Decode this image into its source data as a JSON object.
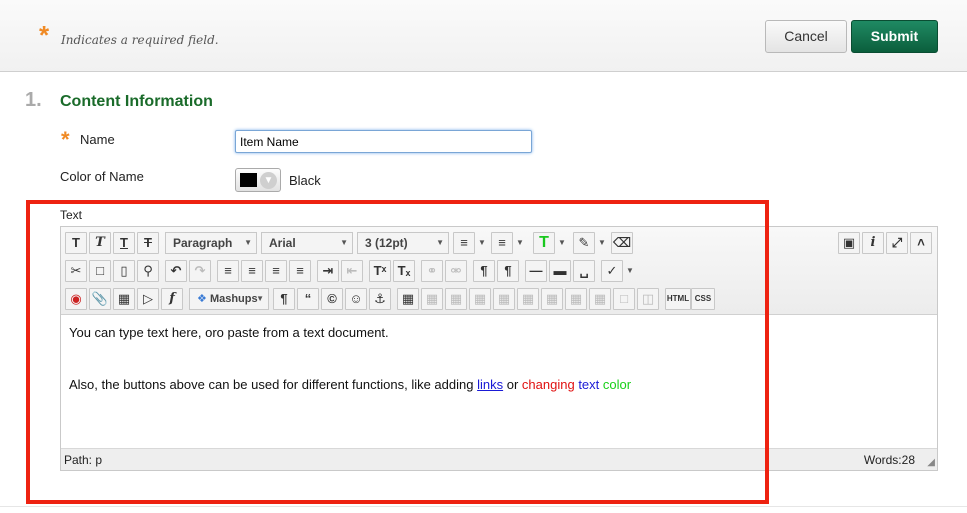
{
  "header": {
    "required_star": "*",
    "required_note": "Indicates a required field.",
    "cancel_label": "Cancel",
    "submit_label": "Submit"
  },
  "section": {
    "number": "1.",
    "title": "Content Information"
  },
  "form": {
    "name_star": "*",
    "name_label": "Name",
    "name_value": "Item Name",
    "color_label": "Color of Name",
    "color_value": "Black",
    "color_swatch_hex": "#000000",
    "text_label": "Text"
  },
  "editor": {
    "paragraph_select": "Paragraph",
    "font_select": "Arial",
    "size_select": "3 (12pt)",
    "mashups_label": "Mashups",
    "html_label": "HTML",
    "css_label": "CSS",
    "icons": {
      "row1": [
        "bold-icon",
        "italic-icon",
        "underline-icon",
        "strikethrough-icon",
        "bullet-list-icon",
        "numbered-list-icon",
        "text-color-icon",
        "highlight-icon",
        "eraser-icon",
        "preview-icon",
        "info-icon",
        "fullscreen-icon",
        "collapse-icon"
      ],
      "row2": [
        "cut-icon",
        "copy-icon",
        "paste-icon",
        "find-icon",
        "undo-icon",
        "redo-icon",
        "align-left-icon",
        "align-center-icon",
        "align-right-icon",
        "justify-icon",
        "indent-icon",
        "outdent-icon",
        "superscript-icon",
        "subscript-icon",
        "link-icon",
        "unlink-icon",
        "ltr-icon",
        "rtl-icon",
        "horizontal-rule-icon",
        "thick-rule-icon",
        "nonbreaking-space-icon",
        "spellcheck-icon"
      ],
      "row3": [
        "record-icon",
        "attach-icon",
        "image-icon",
        "media-icon",
        "formula-icon",
        "pilcrow-icon",
        "quote-icon",
        "copyright-icon",
        "emoticon-icon",
        "anchor-icon",
        "table-icon",
        "table-row-icon",
        "table-col-icon"
      ]
    },
    "content": {
      "line1": "You can type text here, oro paste from a text document.",
      "line2_prefix": "Also, the buttons above can be used for different functions, like adding ",
      "line2_link": "links",
      "line2_or": " or ",
      "line2_changing": "changing",
      "line2_text": "text",
      "line2_color": "color"
    },
    "path_label": "Path:",
    "path_value": "p",
    "words_label": "Words:",
    "words_count": "28"
  },
  "colors": {
    "highlight_border": "#ee2211",
    "submit_bg": "#0b5e3c",
    "section_title": "#1a6b2a",
    "required_star": "#f08a24"
  }
}
